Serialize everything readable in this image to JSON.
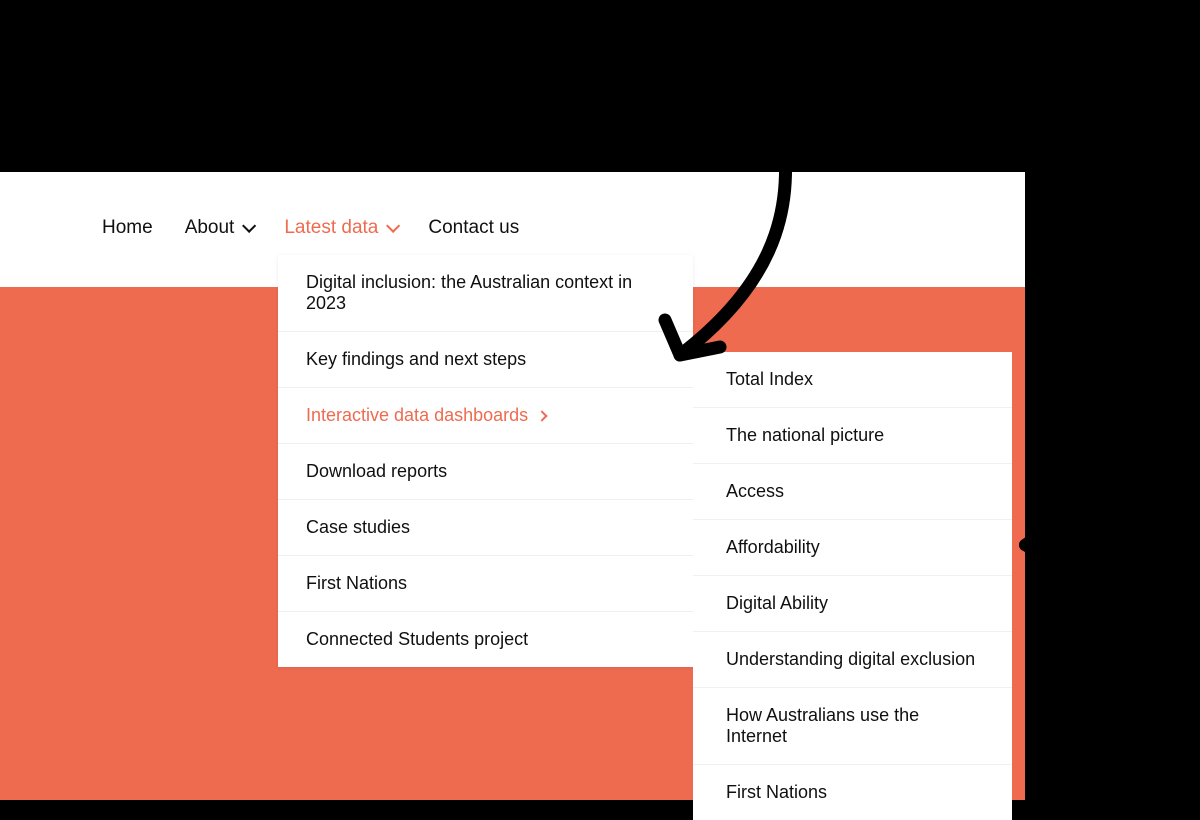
{
  "colors": {
    "accent": "#ee6b50",
    "text": "#101010",
    "background_dark": "#000000",
    "background_light": "#ffffff"
  },
  "nav": {
    "items": [
      {
        "label": "Home",
        "has_submenu": false,
        "active": false
      },
      {
        "label": "About",
        "has_submenu": true,
        "active": false
      },
      {
        "label": "Latest data",
        "has_submenu": true,
        "active": true
      },
      {
        "label": "Contact us",
        "has_submenu": false,
        "active": false
      }
    ]
  },
  "dropdown": {
    "items": [
      {
        "label": "Digital inclusion: the Australian context in 2023",
        "has_submenu": false,
        "active": false
      },
      {
        "label": "Key findings and next steps",
        "has_submenu": false,
        "active": false
      },
      {
        "label": "Interactive data dashboards",
        "has_submenu": true,
        "active": true
      },
      {
        "label": "Download reports",
        "has_submenu": false,
        "active": false
      },
      {
        "label": "Case studies",
        "has_submenu": false,
        "active": false
      },
      {
        "label": "First Nations",
        "has_submenu": false,
        "active": false
      },
      {
        "label": "Connected Students project",
        "has_submenu": false,
        "active": false
      }
    ]
  },
  "submenu": {
    "items": [
      {
        "label": "Total Index"
      },
      {
        "label": "The national picture"
      },
      {
        "label": "Access"
      },
      {
        "label": "Affordability"
      },
      {
        "label": "Digital Ability"
      },
      {
        "label": "Understanding digital exclusion"
      },
      {
        "label": "How Australians use the Internet"
      },
      {
        "label": "First Nations"
      }
    ]
  }
}
